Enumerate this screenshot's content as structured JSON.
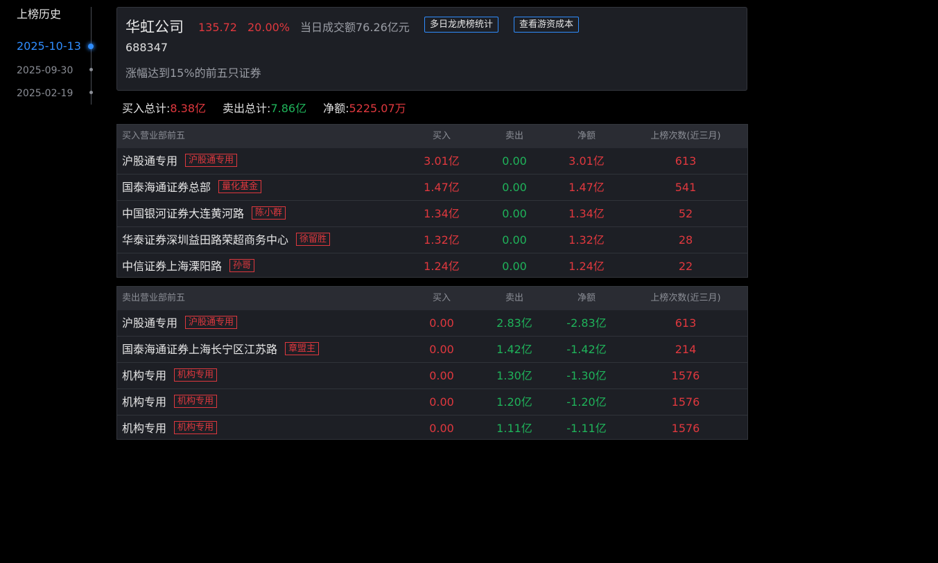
{
  "timeline": {
    "title": "上榜历史",
    "items": [
      {
        "date": "2025-10-13",
        "active": true
      },
      {
        "date": "2025-09-30",
        "active": false
      },
      {
        "date": "2025-02-19",
        "active": false
      }
    ]
  },
  "stock": {
    "name": "华虹公司",
    "price": "135.72",
    "change_pct": "20.00%",
    "turnover": "当日成交额76.26亿元",
    "code": "688347",
    "reason": "涨幅达到15%的前五只证券",
    "btn_multi_day": "多日龙虎榜统计",
    "btn_cost": "查看游资成本"
  },
  "totals": {
    "buy_label": "买入总计:",
    "buy_value": "8.38亿",
    "sell_label": "卖出总计:",
    "sell_value": "7.86亿",
    "net_label": "净额:",
    "net_value": "5225.07万"
  },
  "buy_table": {
    "headers": [
      "买入营业部前五",
      "买入",
      "卖出",
      "净额",
      "上榜次数(近三月)"
    ],
    "rows": [
      {
        "name": "沪股通专用",
        "tag": "沪股通专用",
        "buy": "3.01亿",
        "sell": "0.00",
        "net": "3.01亿",
        "count": "613"
      },
      {
        "name": "国泰海通证券总部",
        "tag": "量化基金",
        "buy": "1.47亿",
        "sell": "0.00",
        "net": "1.47亿",
        "count": "541"
      },
      {
        "name": "中国银河证券大连黄河路",
        "tag": "陈小群",
        "buy": "1.34亿",
        "sell": "0.00",
        "net": "1.34亿",
        "count": "52"
      },
      {
        "name": "华泰证券深圳益田路荣超商务中心",
        "tag": "徐留胜",
        "buy": "1.32亿",
        "sell": "0.00",
        "net": "1.32亿",
        "count": "28"
      },
      {
        "name": "中信证券上海溧阳路",
        "tag": "孙哥",
        "buy": "1.24亿",
        "sell": "0.00",
        "net": "1.24亿",
        "count": "22"
      }
    ]
  },
  "sell_table": {
    "headers": [
      "卖出营业部前五",
      "买入",
      "卖出",
      "净额",
      "上榜次数(近三月)"
    ],
    "rows": [
      {
        "name": "沪股通专用",
        "tag": "沪股通专用",
        "buy": "0.00",
        "sell": "2.83亿",
        "net": "-2.83亿",
        "count": "613"
      },
      {
        "name": "国泰海通证券上海长宁区江苏路",
        "tag": "章盟主",
        "buy": "0.00",
        "sell": "1.42亿",
        "net": "-1.42亿",
        "count": "214"
      },
      {
        "name": "机构专用",
        "tag": "机构专用",
        "buy": "0.00",
        "sell": "1.30亿",
        "net": "-1.30亿",
        "count": "1576"
      },
      {
        "name": "机构专用",
        "tag": "机构专用",
        "buy": "0.00",
        "sell": "1.20亿",
        "net": "-1.20亿",
        "count": "1576"
      },
      {
        "name": "机构专用",
        "tag": "机构专用",
        "buy": "0.00",
        "sell": "1.11亿",
        "net": "-1.11亿",
        "count": "1576"
      }
    ]
  },
  "colors": {
    "up": "#e0383e",
    "down": "#1fb35a",
    "accent": "#2f8dff"
  }
}
